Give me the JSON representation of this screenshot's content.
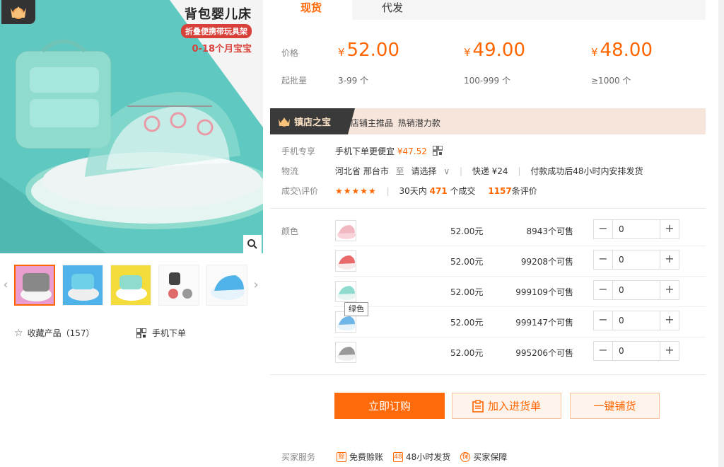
{
  "gallery": {
    "title": "背包婴儿床",
    "badge": "折叠便携带玩具架",
    "subtitle": "0-18个月宝宝",
    "thumbs": [
      "thumb-1",
      "thumb-2",
      "thumb-3",
      "thumb-4",
      "thumb-5"
    ],
    "collect_label": "收藏产品（157）",
    "mobile_order_label": "手机下单"
  },
  "tabs": [
    "现货",
    "代发"
  ],
  "pricing": {
    "price_label": "价格",
    "qty_label": "起批量",
    "currency": "¥",
    "tiers": [
      {
        "price": "52.00",
        "qty": "3-99 个"
      },
      {
        "price": "49.00",
        "qty": "100-999 个"
      },
      {
        "price": "48.00",
        "qty": "≥1000 个"
      }
    ]
  },
  "shop_bar": {
    "title": "镇店之宝",
    "text": "店铺主推品 热销潜力款"
  },
  "info": {
    "mobile_label": "手机专享",
    "mobile_text": "手机下单更便宜",
    "mobile_price": "¥47.52",
    "logistics_label": "物流",
    "origin": "河北省 邢台市",
    "to": "至",
    "destination": "请选择",
    "express": "快递 ¥24",
    "ship_note": "付款成功后48小时内安排发货",
    "deal_label": "成交\\评价",
    "stars": "★★★★★",
    "deal_prefix": "30天内",
    "deal_count": "471",
    "deal_suffix": "个成交",
    "review_count": "1157",
    "review_suffix": "条评价"
  },
  "sku": {
    "color_label": "颜色",
    "tooltip": "绿色",
    "items": [
      {
        "price": "52.00元",
        "stock": "8943个可售",
        "qty": "0",
        "color": "#f2b8c2"
      },
      {
        "price": "52.00元",
        "stock": "99208个可售",
        "qty": "0",
        "color": "#e96a6a"
      },
      {
        "price": "52.00元",
        "stock": "999109个可售",
        "qty": "0",
        "color": "#8fdccf"
      },
      {
        "price": "52.00元",
        "stock": "999147个可售",
        "qty": "0",
        "color": "#6fb6e8"
      },
      {
        "price": "52.00元",
        "stock": "995206个可售",
        "qty": "0",
        "color": "#9a9a9a"
      }
    ]
  },
  "actions": {
    "buy": "立即订购",
    "add": "加入进货单",
    "pu": "一键铺货"
  },
  "services": {
    "label": "买家服务",
    "items": [
      {
        "icon": "赊",
        "label": "免费赊账"
      },
      {
        "icon": "48",
        "label": "48小时发货"
      },
      {
        "icon": "保",
        "label": "买家保障"
      }
    ]
  },
  "colors": {
    "accent": "#ff6600",
    "product_mint": "#8fdccf",
    "shop_bar_bg": "#f6e5da",
    "shop_dark": "#3a3a3a"
  }
}
